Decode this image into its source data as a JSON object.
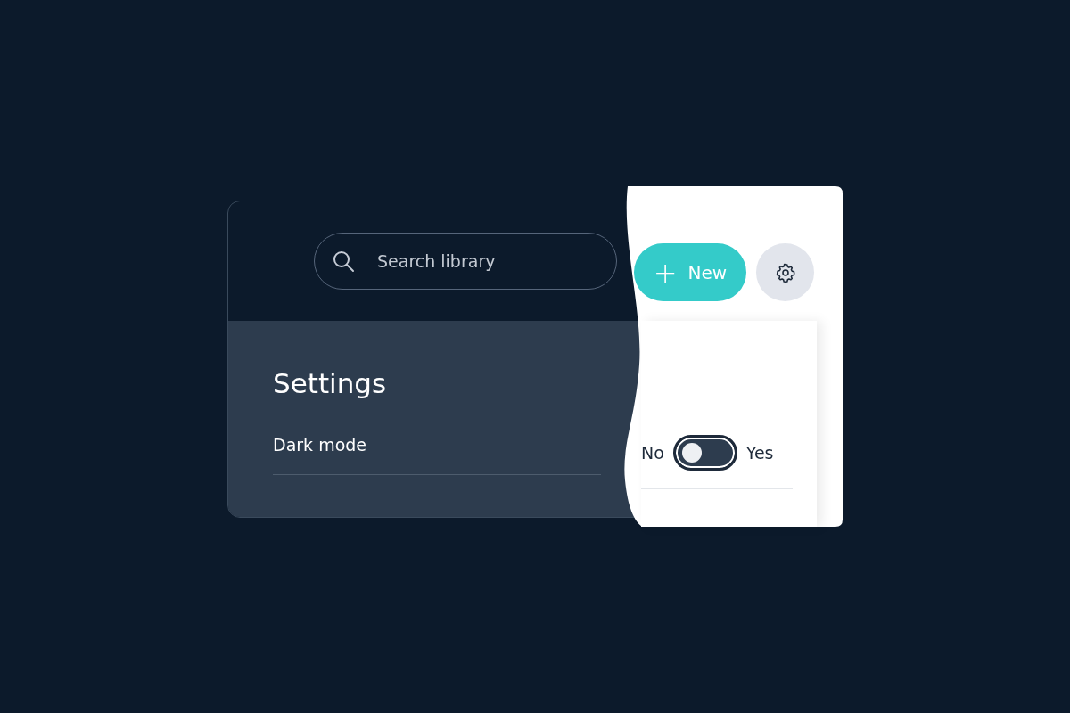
{
  "search": {
    "placeholder": "Search library"
  },
  "new_button": {
    "icon": "+",
    "label": "New"
  },
  "settings": {
    "title": "Settings",
    "rows": [
      {
        "kind": "toggle",
        "label": "Dark mode",
        "off_label": "No",
        "on_label": "Yes",
        "on": false
      }
    ]
  }
}
